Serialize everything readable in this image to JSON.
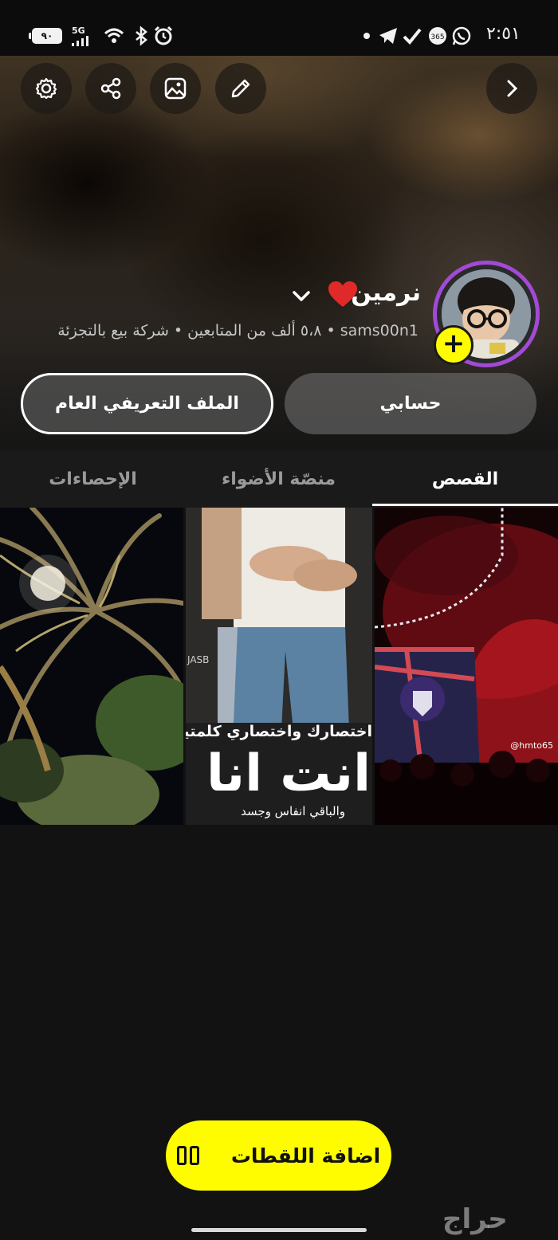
{
  "status_bar": {
    "time": "٢:٥١",
    "battery": "٩٠",
    "network": "5G"
  },
  "header": {
    "icons": [
      "settings-icon",
      "share-icon",
      "image-icon",
      "pencil-icon",
      "chevron-right-icon"
    ]
  },
  "profile": {
    "name": "نرمين",
    "subtitle": "sams00n1 • ٥،٨ ألف من المتابعين • شركة بيع بالتجزئة",
    "ring_color": "#a24ad6"
  },
  "actions": {
    "account_label": "حسابي",
    "public_profile_label": "الملف التعريفي العام"
  },
  "tabs": [
    {
      "label": "القصص",
      "active": true
    },
    {
      "label": "منصّة الأضواء",
      "active": false
    },
    {
      "label": "الإحصاءات",
      "active": false
    }
  ],
  "tiles": {
    "tile2_line1": "اختصارك واختصاري كلمتين :",
    "tile2_big": "انت انا",
    "tile2_line3": "والباقي انفاس وجسد",
    "tile2_small": "JASB",
    "tile3_handle": "@hmto65"
  },
  "bottom": {
    "add_snaps_label": "اضافة اللقطات",
    "watermark": "حراج"
  },
  "colors": {
    "accent_yellow": "#fffc00",
    "background": "#121212"
  }
}
